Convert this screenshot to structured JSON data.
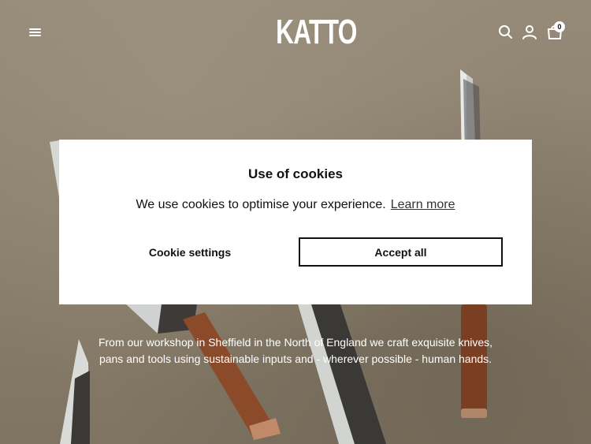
{
  "header": {
    "logo_text": "KATTO",
    "cart_count": "0"
  },
  "hero": {
    "intro_text": "From our workshop in Sheffield in the North of England we craft exquisite knives, pans and tools using sustainable inputs and - wherever possible - human hands."
  },
  "cookie_modal": {
    "title": "Use of cookies",
    "message": "We use cookies to optimise your experience.",
    "learn_more_label": "Learn more",
    "settings_button_label": "Cookie settings",
    "accept_button_label": "Accept all"
  },
  "icons": {
    "menu": "menu-icon",
    "search": "search-icon",
    "account": "account-icon",
    "cart": "bag-icon"
  }
}
